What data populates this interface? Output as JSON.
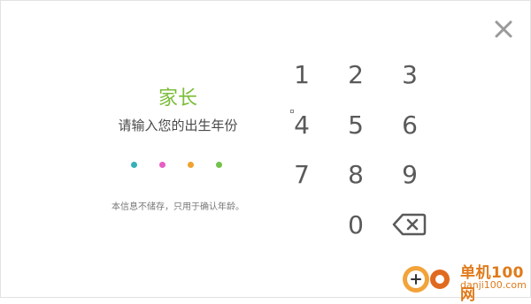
{
  "close_icon": "close-icon",
  "title": "家长",
  "subtitle": "请输入您的出生年份",
  "pin_dots": [
    "#33b1b7",
    "#e85cc4",
    "#f0a22e",
    "#72c24a"
  ],
  "notice": "本信息不储存，只用于确认年龄。",
  "keypad": {
    "keys": [
      "1",
      "2",
      "3",
      "4",
      "5",
      "6",
      "7",
      "8",
      "9",
      "0"
    ],
    "backspace_icon": "backspace-icon"
  },
  "watermark": {
    "brand": "单机100网",
    "url": "danji100.com"
  }
}
